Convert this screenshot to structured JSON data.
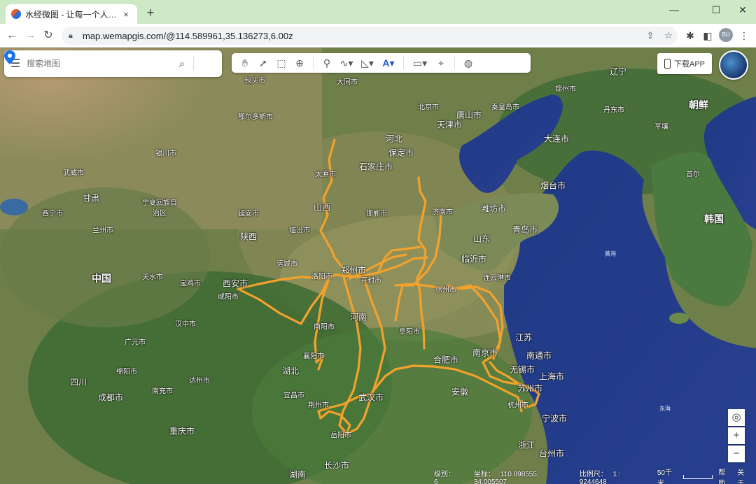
{
  "browser": {
    "tab_title": "水经微图 - 让每一个人都有自己",
    "tab_close": "×",
    "new_tab": "+",
    "url": "map.wemapgis.com/@114.589961,35.136273,6.00z",
    "profile_initials": "BU",
    "window_controls": {
      "minimize": "—",
      "maximize": "☐",
      "close": "✕"
    }
  },
  "map_ui": {
    "search_placeholder": "搜索地图",
    "download_app": "下载APP",
    "zoom_in": "+",
    "zoom_out": "−",
    "locate_icon": "◎"
  },
  "status": {
    "level_label": "级别：",
    "level_value": "6",
    "coord_label": "坐标：",
    "coord_value": "110.898555, 34.005507",
    "scale_label": "比例尺：",
    "scale_value": "1 : 9244648",
    "scale_bar": "50千米",
    "help": "帮助",
    "about": "关于"
  },
  "labels": {
    "china": "中国",
    "hebei": "河北",
    "shanxi": "山西",
    "shaanxi": "陕西",
    "henan": "河南",
    "hubei": "湖北",
    "shandong": "山东",
    "anhui": "安徽",
    "jiangsu": "江苏",
    "zhejiang": "浙江",
    "hunan": "湖南",
    "sichuan": "四川",
    "gansu": "甘肃",
    "ningxia": "宁夏回族自治区",
    "chaoxian": "朝鲜",
    "hanguo": "韩国",
    "liaoning": "辽宁",
    "pyongyang": "平壤",
    "seoul": "首尔",
    "beijing": "北京市",
    "tianjin": "天津市",
    "tangshan": "唐山市",
    "qinhuangdao": "秦皇岛市",
    "dalian": "大连市",
    "shijiazhuang": "石家庄市",
    "baoding": "保定市",
    "taiyuan": "太原市",
    "jinan": "济南市",
    "weifang": "潍坊市",
    "qingdao": "青岛市",
    "yantai": "烟台市",
    "linyi": "临沂市",
    "lianyungang": "连云港市",
    "xuzhou": "徐州市",
    "zhengzhou": "郑州市",
    "kaifeng": "开封市",
    "luoyang": "洛阳市",
    "xian": "西安市",
    "xianyang": "咸阳市",
    "baoji": "宝鸡市",
    "tianshui": "天水市",
    "lanzhou": "兰州市",
    "xining": "西宁市",
    "yinchuan": "银川市",
    "wuhan": "武汉市",
    "yichang": "宜昌市",
    "jingzhou": "荆州市",
    "yueyang": "岳阳市",
    "changsha": "长沙市",
    "nanjing": "南京市",
    "hefei": "合肥市",
    "shanghai": "上海市",
    "suzhou": "苏州市",
    "wuxi": "无锡市",
    "nantong": "南通市",
    "ningbo": "宁波市",
    "taizhou": "台州市",
    "hangzhou": "杭州市",
    "chongqing": "重庆市",
    "chengdu": "成都市",
    "nanchong": "南充市",
    "dazhou": "达州市",
    "hanzhong": "汉中市",
    "mianyang": "绵阳市",
    "guangyuan": "广元市",
    "ordos": "鄂尔多斯市",
    "baotou": "包头市",
    "handan": "邯郸市",
    "linfen": "临汾市",
    "yuncheng": "运城市",
    "nanyang": "南阳市",
    "fuyang": "阜阳市",
    "xiangyang": "襄阳市",
    "huanghai": "黄海",
    "donghai": "东海",
    "jinzhou": "锦州市",
    "dandong": "丹东市",
    "wuwei": "武威市",
    "yan_an": "延安市",
    "datong": "大同市"
  }
}
